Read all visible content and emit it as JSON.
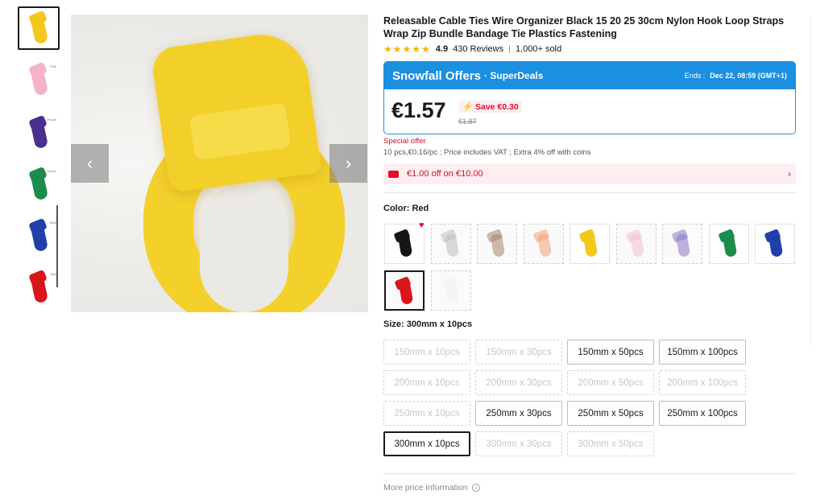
{
  "thumbnails": [
    {
      "color": "#f2c81b",
      "tag": "",
      "active": true
    },
    {
      "color": "#f5b3c8",
      "tag": "Pink",
      "active": false
    },
    {
      "color": "#4a2f8f",
      "tag": "Purple",
      "active": false
    },
    {
      "color": "#1c8c4c",
      "tag": "Green",
      "active": false
    },
    {
      "color": "#1f3faa",
      "tag": "Blue",
      "active": false
    },
    {
      "color": "#d9151b",
      "tag": "Red",
      "active": false
    }
  ],
  "gallery": {
    "prev_icon": "chevron-left-icon",
    "next_icon": "chevron-right-icon",
    "main_color": "#f4d02b"
  },
  "product": {
    "title": "Releasable Cable Ties Wire Organizer Black 15 20 25 30cm Nylon Hook Loop Straps Wrap Zip Bundle Bandage Tie Plastics Fastening",
    "stars": "★★★★★",
    "rating": "4.9",
    "reviews": "430 Reviews",
    "separator": "|",
    "sold": "1,000+ sold"
  },
  "offer": {
    "brand": "Snowfall Offers",
    "super": "· SuperDeals",
    "ends_label": "Ends :",
    "ends_value": "Dec 22, 08:59 (GMT+1)",
    "price": "€1.57",
    "save": "Save €0.30",
    "old_price": "€1.87",
    "accent": "#1b8fe0"
  },
  "special_offer": "Special offer",
  "price_note": "10 pcs,€0.16/pc ; Price includes VAT ; Extra 4% off with coins",
  "coupon": {
    "text": "€1.00 off on €10.00",
    "arrow": "›"
  },
  "color_label": "Color: Red",
  "colors": [
    {
      "name": "Black",
      "hex": "#151515",
      "state": "avail"
    },
    {
      "name": "Grey",
      "hex": "#bdbdbd",
      "state": "na"
    },
    {
      "name": "Brown",
      "hex": "#a9806a",
      "state": "na"
    },
    {
      "name": "Orange",
      "hex": "#f4a077",
      "state": "na"
    },
    {
      "name": "Yellow",
      "hex": "#f2c81b",
      "state": "avail"
    },
    {
      "name": "Pink",
      "hex": "#f5bfd0",
      "state": "na"
    },
    {
      "name": "Purple",
      "hex": "#8a76c2",
      "state": "na"
    },
    {
      "name": "Green",
      "hex": "#1c8c4c",
      "state": "avail"
    },
    {
      "name": "Blue",
      "hex": "#1f3faa",
      "state": "avail"
    },
    {
      "name": "Red",
      "hex": "#d9151b",
      "state": "selected"
    },
    {
      "name": "White",
      "hex": "#f1f1f1",
      "state": "na"
    }
  ],
  "size_label": "Size: 300mm x 10pcs",
  "sizes": [
    {
      "label": "150mm x 10pcs",
      "state": "na"
    },
    {
      "label": "150mm x 30pcs",
      "state": "na"
    },
    {
      "label": "150mm x 50pcs",
      "state": "avail"
    },
    {
      "label": "150mm x 100pcs",
      "state": "avail"
    },
    {
      "label": "200mm x 10pcs",
      "state": "na"
    },
    {
      "label": "200mm x 30pcs",
      "state": "na"
    },
    {
      "label": "200mm x 50pcs",
      "state": "na"
    },
    {
      "label": "200mm x 100pcs",
      "state": "na"
    },
    {
      "label": "250mm x 10pcs",
      "state": "na"
    },
    {
      "label": "250mm x 30pcs",
      "state": "avail"
    },
    {
      "label": "250mm x 50pcs",
      "state": "avail"
    },
    {
      "label": "250mm x 100pcs",
      "state": "avail"
    },
    {
      "label": "300mm x 10pcs",
      "state": "selected"
    },
    {
      "label": "300mm x 30pcs",
      "state": "na"
    },
    {
      "label": "300mm x 50pcs",
      "state": "na"
    }
  ],
  "more_info": "More price information",
  "info_icon": "i"
}
